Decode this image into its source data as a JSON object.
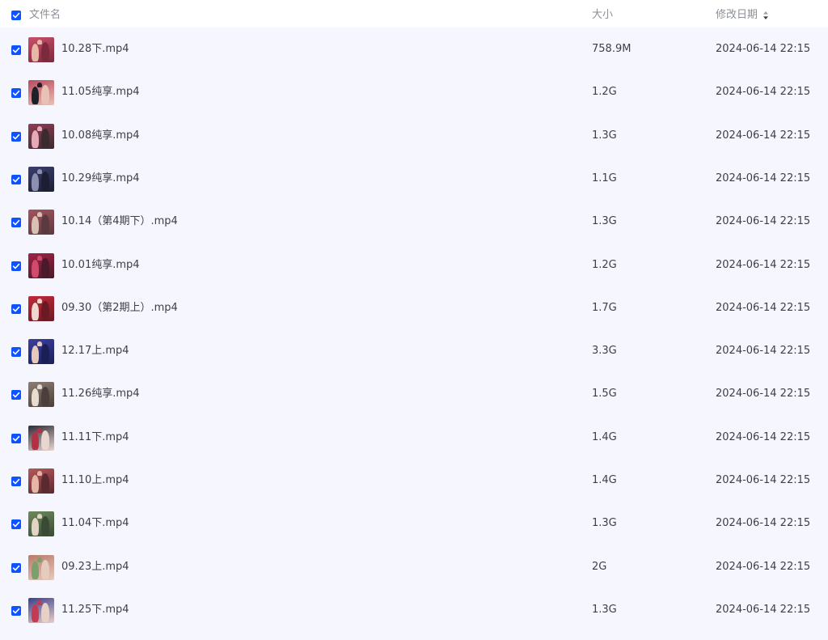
{
  "header": {
    "name_label": "文件名",
    "size_label": "大小",
    "date_label": "修改日期",
    "select_all_checked": true,
    "sort_icon": "sort-updown-icon"
  },
  "colors": {
    "accent": "#0d53ff",
    "list_background": "#f6f7fe",
    "header_text": "#8a8f99",
    "row_text": "#3c3f45"
  },
  "files": [
    {
      "name": "10.28下.mp4",
      "size": "758.9M",
      "date": "2024-06-14 22:15",
      "checked": true,
      "thumb": [
        "#c94f6a",
        "#e8b7a6",
        "#7a2a3c"
      ]
    },
    {
      "name": "11.05纯享.mp4",
      "size": "1.2G",
      "date": "2024-06-14 22:15",
      "checked": true,
      "thumb": [
        "#b84a5e",
        "#1f1f2a",
        "#e9c2b5"
      ]
    },
    {
      "name": "10.08纯享.mp4",
      "size": "1.3G",
      "date": "2024-06-14 22:15",
      "checked": true,
      "thumb": [
        "#8f3e52",
        "#e5a9b8",
        "#3b2a30"
      ]
    },
    {
      "name": "10.29纯享.mp4",
      "size": "1.1G",
      "date": "2024-06-14 22:15",
      "checked": true,
      "thumb": [
        "#3a3f6e",
        "#8c8fb0",
        "#1c1e33"
      ]
    },
    {
      "name": "10.14（第4期下）.mp4",
      "size": "1.3G",
      "date": "2024-06-14 22:15",
      "checked": true,
      "thumb": [
        "#a3545e",
        "#d9c0b5",
        "#5b3a3f"
      ]
    },
    {
      "name": "10.01纯享.mp4",
      "size": "1.2G",
      "date": "2024-06-14 22:15",
      "checked": true,
      "thumb": [
        "#a12346",
        "#d14a6c",
        "#4a1a2a"
      ]
    },
    {
      "name": "09.30（第2期上）.mp4",
      "size": "1.7G",
      "date": "2024-06-14 22:15",
      "checked": true,
      "thumb": [
        "#c42a3a",
        "#f0d8cf",
        "#6b1a24"
      ]
    },
    {
      "name": "12.17上.mp4",
      "size": "3.3G",
      "date": "2024-06-14 22:15",
      "checked": true,
      "thumb": [
        "#3b3f9e",
        "#e8c8b8",
        "#1c1f55"
      ]
    },
    {
      "name": "11.26纯享.mp4",
      "size": "1.5G",
      "date": "2024-06-14 22:15",
      "checked": true,
      "thumb": [
        "#8d7e74",
        "#e8dcd0",
        "#4a3f3a"
      ]
    },
    {
      "name": "11.11下.mp4",
      "size": "1.4G",
      "date": "2024-06-14 22:15",
      "checked": true,
      "thumb": [
        "#2b2b36",
        "#b52f45",
        "#e9d6cf"
      ]
    },
    {
      "name": "11.10上.mp4",
      "size": "1.4G",
      "date": "2024-06-14 22:15",
      "checked": true,
      "thumb": [
        "#b5585c",
        "#e6b5a6",
        "#5a2a2e"
      ]
    },
    {
      "name": "11.04下.mp4",
      "size": "1.3G",
      "date": "2024-06-14 22:15",
      "checked": true,
      "thumb": [
        "#6b8a5a",
        "#e3d3c4",
        "#3a4a35"
      ]
    },
    {
      "name": "09.23上.mp4",
      "size": "2G",
      "date": "2024-06-14 22:15",
      "checked": true,
      "thumb": [
        "#b87a6a",
        "#7aa06b",
        "#e6cbbf"
      ]
    },
    {
      "name": "11.25下.mp4",
      "size": "1.3G",
      "date": "2024-06-14 22:15",
      "checked": true,
      "thumb": [
        "#3a3f8c",
        "#c43a52",
        "#e9d0c6"
      ]
    }
  ]
}
